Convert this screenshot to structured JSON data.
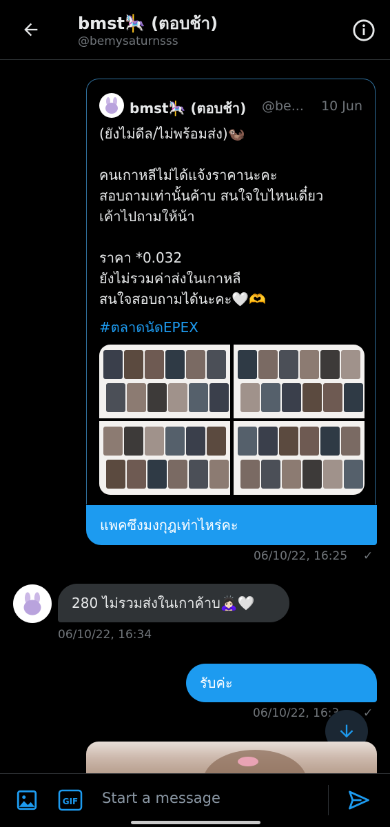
{
  "header": {
    "title": "bmst🎠 (ตอบช้า)",
    "handle": "@bemysaturnsss",
    "back_icon": "arrow-left-icon",
    "info_icon": "info-icon"
  },
  "quoted_tweet": {
    "name": "bmst🎠 (ตอบช้า)",
    "handle": "@be...",
    "date": "10 Jun",
    "text": "(ยังไม่ดีล/ไม่พร้อมส่ง)🦦\n\nคนเกาหลีไม่ได้แจ้งราคานะคะ\nสอบถามเท่านั้นค้าบ สนใจใบไหนเดี๋ยว\nเค้าไปถามให้น้า\n\nราคา *0.032\nยังไม่รวมค่าส่งในเกาหลี\nสนใจสอบถามได้นะคะ🤍🫶",
    "hashtag": "#ตลาดนัดEPEX"
  },
  "messages": [
    {
      "direction": "out",
      "text": "แพคซึงมงกุฎเท่าไหร่คะ",
      "time": "06/10/22, 16:25",
      "status": "✓"
    },
    {
      "direction": "in",
      "text": "280 ไม่รวมส่งในเกาค้าบ🙇🏻‍♀️🤍",
      "time": "06/10/22, 16:34"
    },
    {
      "direction": "out",
      "text": "รับค่ะ",
      "time": "06/10/22, 16:3",
      "status": "✓"
    }
  ],
  "composer": {
    "placeholder": "Start a message",
    "image_icon": "image-icon",
    "gif_label": "GIF",
    "send_icon": "send-icon"
  },
  "colors": {
    "accent": "#1d9bf0",
    "incoming_bubble": "#2f3336",
    "background": "#000000",
    "muted_text": "#71767b"
  }
}
